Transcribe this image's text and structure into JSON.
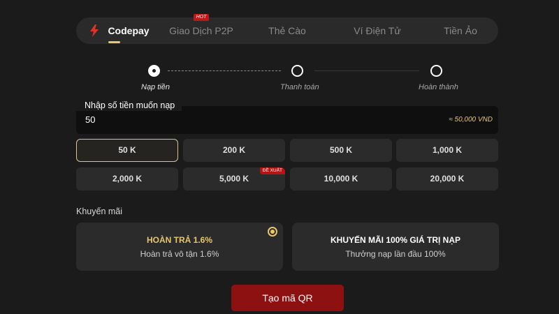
{
  "tabs": [
    {
      "label": "Codepay",
      "active": true
    },
    {
      "label": "Giao Dịch P2P",
      "badge": "HOT"
    },
    {
      "label": "Thẻ Cào"
    },
    {
      "label": "Ví Điện Tử"
    },
    {
      "label": "Tiền Ảo"
    }
  ],
  "steps": [
    {
      "label": "Nạp tiền",
      "active": true
    },
    {
      "label": "Thanh toán",
      "active": false
    },
    {
      "label": "Hoàn thành",
      "active": false
    }
  ],
  "amount": {
    "label": "Nhập số tiền muốn nạp",
    "value": "50",
    "converted": "≈ 50,000 VND"
  },
  "amount_options": [
    {
      "label": "50 K",
      "selected": true
    },
    {
      "label": "200 K"
    },
    {
      "label": "500 K"
    },
    {
      "label": "1,000 K"
    },
    {
      "label": "2,000 K"
    },
    {
      "label": "5,000 K",
      "badge": "ĐỀ XUẤT"
    },
    {
      "label": "10,000 K"
    },
    {
      "label": "20,000 K"
    }
  ],
  "promotions": {
    "title": "Khuyến mãi",
    "items": [
      {
        "name": "HOÀN TRẢ 1.6%",
        "desc": "Hoàn trả vô tận 1.6%",
        "selected": true
      },
      {
        "name": "KHUYẾN MÃI 100% GIÁ TRỊ NẠP",
        "desc": "Thưởng nạp lần đầu 100%",
        "selected": false
      }
    ]
  },
  "cta": {
    "label": "Tạo mã QR"
  },
  "colors": {
    "background": "#1b1b1b",
    "accent_gold": "#e8c76a",
    "cta_red": "#8e1111",
    "badge_red": "#c01818",
    "bolt_red": "#e0302a"
  },
  "icons": {
    "codepay_tab": "lightning-bolt-icon",
    "promo_selector": "radio-selected-icon"
  }
}
